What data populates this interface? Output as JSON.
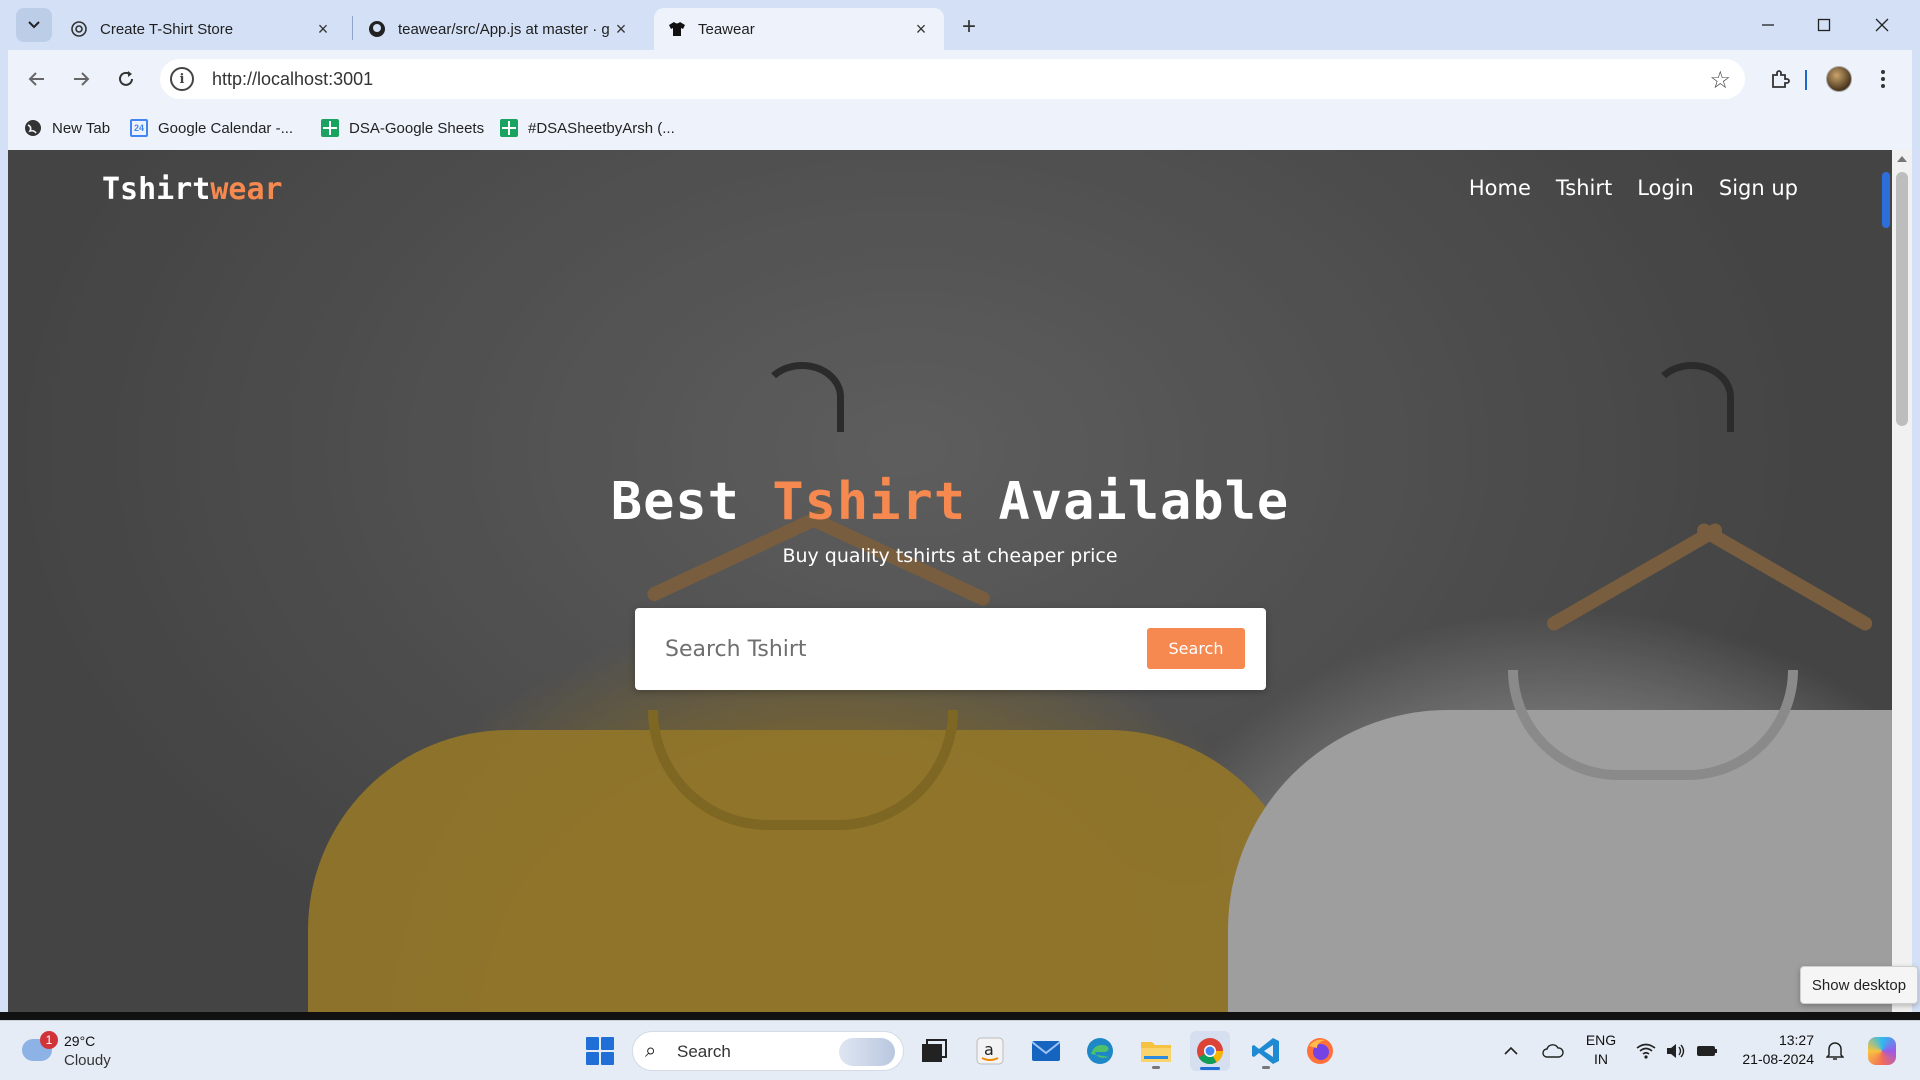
{
  "browser": {
    "tabs": [
      {
        "title": "Create T-Shirt Store",
        "icon": "openai-icon"
      },
      {
        "title": "teawear/src/App.js at master · g",
        "icon": "github-icon"
      },
      {
        "title": "Teawear",
        "icon": "tshirt-icon",
        "active": true
      }
    ],
    "url": "http://localhost:3001",
    "bookmarks": [
      {
        "label": "New Tab"
      },
      {
        "label": "Google Calendar -..."
      },
      {
        "label": "DSA-Google Sheets"
      },
      {
        "label": "#DSASheetbyArsh (..."
      }
    ],
    "calendar_day": "24"
  },
  "site": {
    "brand_main": "Tshirt",
    "brand_accent": "wear",
    "nav": [
      "Home",
      "Tshirt",
      "Login",
      "Sign up"
    ],
    "hero": {
      "title_pre": "Best ",
      "title_accent": "Tshirt",
      "title_post": " Available",
      "subtitle": "Buy quality tshirts at cheaper price"
    },
    "search": {
      "placeholder": "Search Tshirt",
      "button": "Search"
    },
    "accent_color": "#f5894f"
  },
  "tooltip": "Show desktop",
  "taskbar": {
    "weather": {
      "temp": "29°C",
      "condition": "Cloudy",
      "badge": "1"
    },
    "search_label": "Search",
    "lang_line1": "ENG",
    "lang_line2": "IN",
    "time": "13:27",
    "date": "21-08-2024"
  }
}
